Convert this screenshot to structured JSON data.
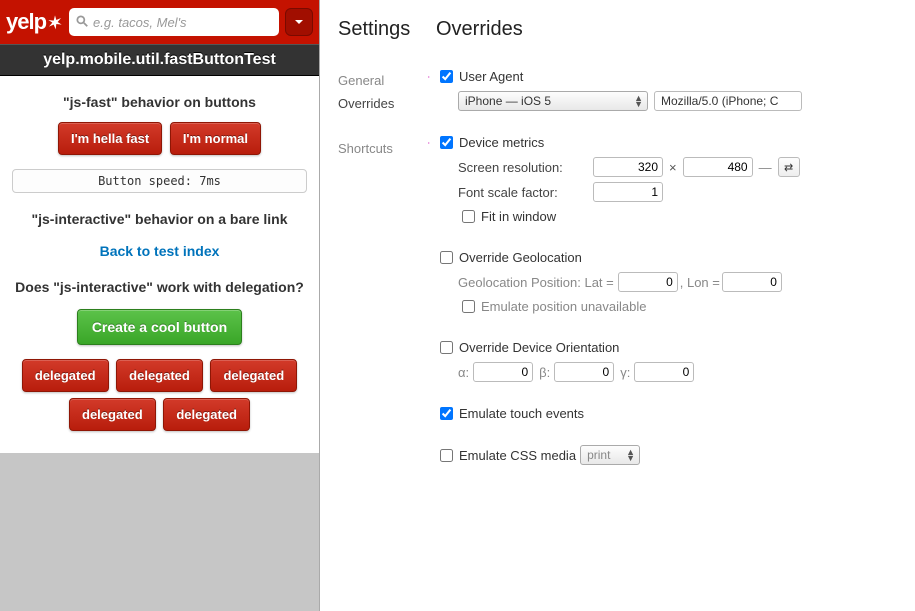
{
  "mobile": {
    "logo_text": "yelp",
    "search_placeholder": "e.g. tacos, Mel's",
    "page_title": "yelp.mobile.util.fastButtonTest",
    "section1_heading": "\"js-fast\" behavior on buttons",
    "btn_fast": "I'm hella fast",
    "btn_normal": "I'm normal",
    "speed_text": "Button speed: 7ms",
    "section2_heading": "\"js-interactive\" behavior on a bare link",
    "link_back": "Back to test index",
    "section3_heading": "Does \"js-interactive\" work with delegation?",
    "btn_green": "Create a cool button",
    "delegated_label": "delegated"
  },
  "devtools": {
    "settings_heading": "Settings",
    "overrides_heading": "Overrides",
    "nav": {
      "general": "General",
      "overrides": "Overrides",
      "shortcuts": "Shortcuts"
    },
    "ua": {
      "label": "User Agent",
      "checked": true,
      "select_value": "iPhone — iOS 5",
      "ua_string": "Mozilla/5.0 (iPhone; C"
    },
    "metrics": {
      "label": "Device metrics",
      "checked": true,
      "res_label": "Screen resolution:",
      "width": "320",
      "height": "480",
      "font_label": "Font scale factor:",
      "font_value": "1",
      "fit_label": "Fit in window",
      "fit_checked": false
    },
    "geo": {
      "label": "Override Geolocation",
      "checked": false,
      "pos_label": "Geolocation Position: Lat =",
      "lat": "0",
      "lon_label": ", Lon =",
      "lon": "0",
      "emu_label": "Emulate position unavailable",
      "emu_checked": false
    },
    "orient": {
      "label": "Override Device Orientation",
      "checked": false,
      "alpha_label": "α:",
      "alpha": "0",
      "beta_label": "β:",
      "beta": "0",
      "gamma_label": "γ:",
      "gamma": "0"
    },
    "touch": {
      "label": "Emulate touch events",
      "checked": true
    },
    "cssmedia": {
      "label": "Emulate CSS media",
      "checked": false,
      "value": "print"
    }
  }
}
